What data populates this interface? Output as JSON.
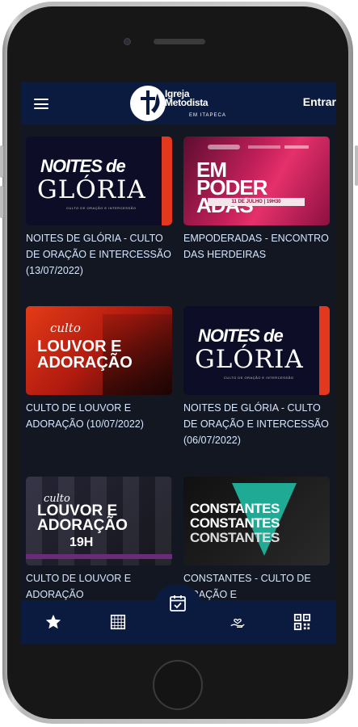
{
  "app": {
    "brand_line1": "Igreja",
    "brand_line2": "Metodista",
    "brand_sub": "EM ITAPECA",
    "login_label": "Entrar"
  },
  "thumbnails": {
    "glory_line1": "NOITES de",
    "glory_line2": "GLÓRIA",
    "glory_line3": "CULTO DE ORAÇÃO E INTERCESSÃO",
    "pink_big": "EM\nPODER\nADAS",
    "pink_date": "11 DE JULHO | 19H30",
    "red_script": "culto",
    "red_title": "LOUVOR E\nADORAÇÃO",
    "dark_script": "culto",
    "dark_title": "LOUVOR E\nADORAÇÃO",
    "dark_time": "19H",
    "const_word": "CONSTANTES"
  },
  "events": [
    {
      "title": "NOITES DE GLÓRIA - CULTO DE ORAÇÃO E INTERCESSÃO (13/07/2022)",
      "theme": "glory"
    },
    {
      "title": "EMPODERADAS - ENCONTRO DAS HERDEIRAS",
      "theme": "pink"
    },
    {
      "title": "CULTO DE LOUVOR E ADORAÇÃO (10/07/2022)",
      "theme": "red"
    },
    {
      "title": "NOITES DE GLÓRIA - CULTO DE ORAÇÃO E INTERCESSÃO (06/07/2022)",
      "theme": "glory"
    },
    {
      "title": "CULTO DE LOUVOR E ADORAÇÃO",
      "theme": "dark"
    },
    {
      "title": "CONSTANTES - CULTO DE ORAÇÃO E",
      "theme": "const"
    }
  ],
  "bottom_nav": [
    {
      "icon": "star-icon",
      "active": false
    },
    {
      "icon": "calendar-grid-icon",
      "active": false
    },
    {
      "icon": "calendar-check-icon",
      "active": true
    },
    {
      "icon": "hand-heart-icon",
      "active": false
    },
    {
      "icon": "qr-code-icon",
      "active": false
    }
  ],
  "colors": {
    "header_bg": "#0b1a3f",
    "screen_bg": "#121722",
    "title_text": "#d6e6ff",
    "accent_red": "#e2381d"
  }
}
